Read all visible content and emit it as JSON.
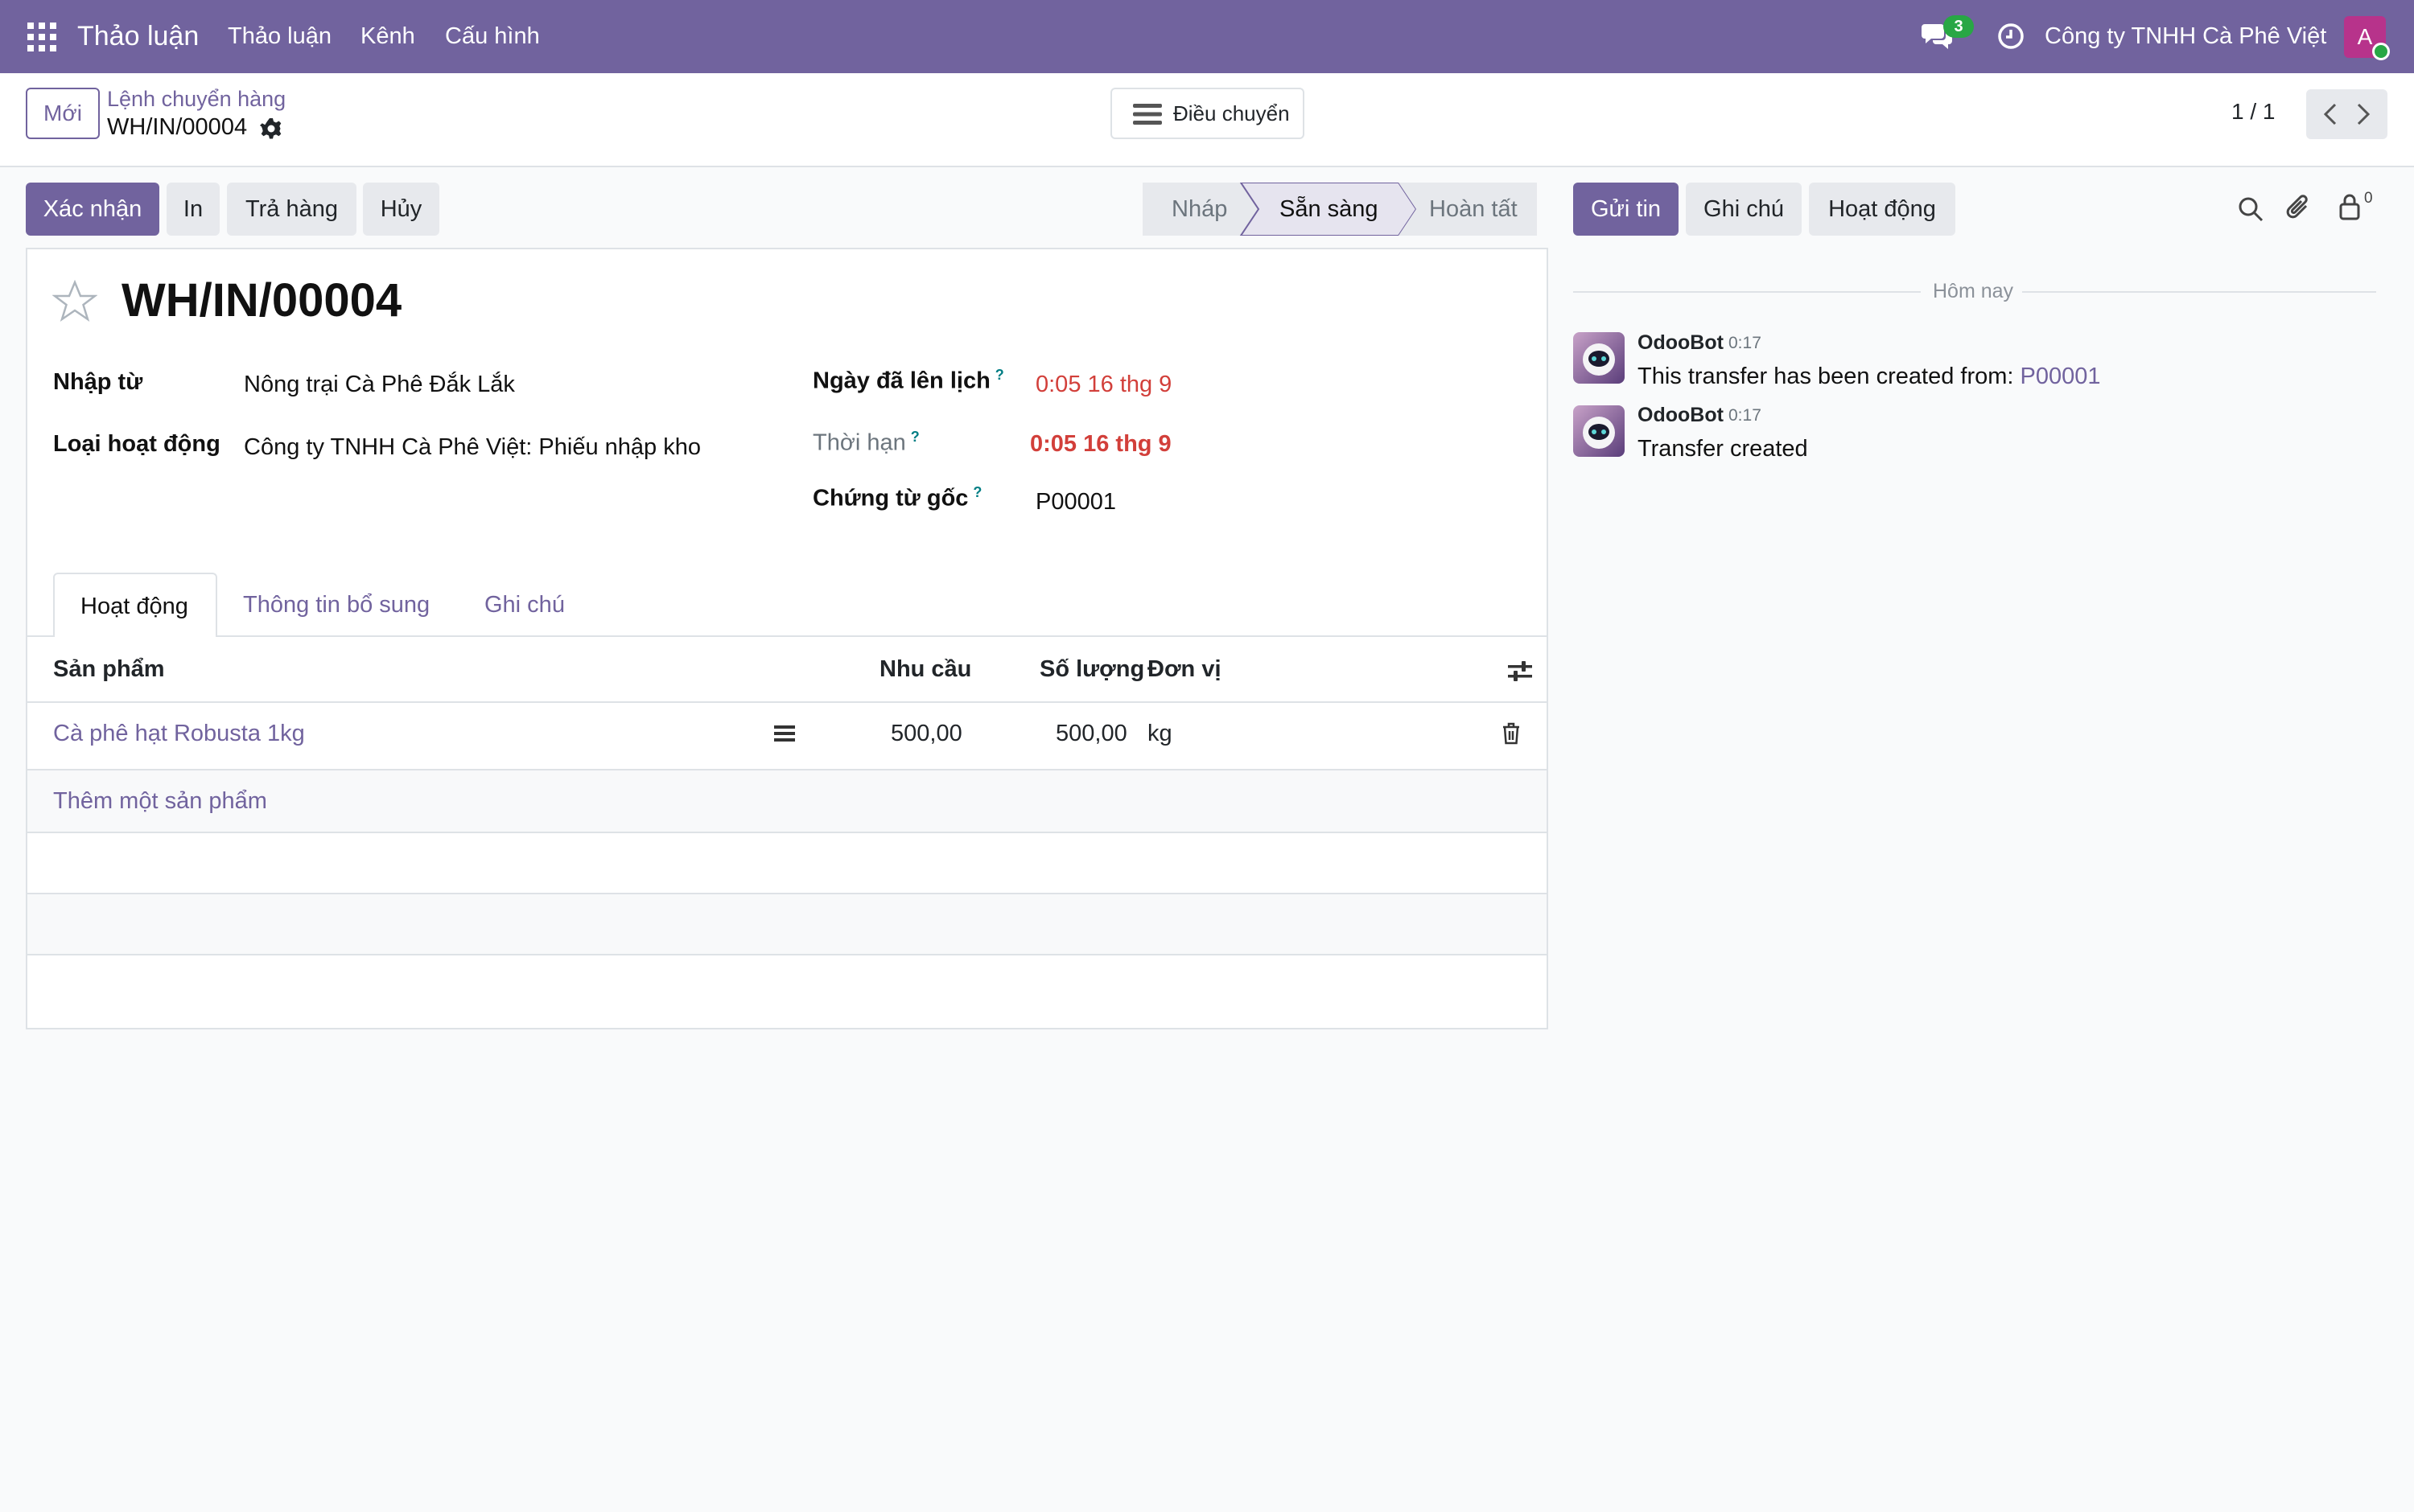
{
  "topbar": {
    "app_name": "Thảo luận",
    "menu": [
      "Thảo luận",
      "Kênh",
      "Cấu hình"
    ],
    "message_count": "3",
    "company": "Công ty TNHH Cà Phê Việt",
    "avatar_letter": "A",
    "bg_color": "#71639e"
  },
  "control_panel": {
    "new_button": "Mới",
    "breadcrumb_parent": "Lệnh chuyển hàng",
    "record_name": "WH/IN/00004",
    "actions_menu": "Điều chuyển",
    "pager": "1 / 1"
  },
  "statusbar": {
    "buttons": [
      "Xác nhận",
      "In",
      "Trả hàng",
      "Hủy"
    ],
    "stages": [
      "Nháp",
      "Sẵn sàng",
      "Hoàn tất"
    ],
    "active_stage": "Sẵn sàng"
  },
  "form": {
    "title": "WH/IN/00004",
    "fields_left": [
      {
        "label": "Nhập từ",
        "value": "Nông trại Cà Phê Đắk Lắk"
      },
      {
        "label": "Loại hoạt động",
        "value": "Công ty TNHH Cà Phê Việt: Phiếu nhập kho"
      }
    ],
    "fields_right": [
      {
        "label": "Ngày đã lên lịch",
        "help": "?",
        "value": "0:05 16 thg 9"
      },
      {
        "label": "Thời hạn",
        "help": "?",
        "value": "0:05 16 thg 9"
      },
      {
        "label": "Chứng từ gốc",
        "help": "?",
        "value": "P00001"
      }
    ],
    "tabs": [
      "Hoạt động",
      "Thông tin bổ sung",
      "Ghi chú"
    ],
    "active_tab": "Hoạt động",
    "table": {
      "headers": [
        "Sản phẩm",
        "Nhu cầu",
        "Số lượng",
        "Đơn vị"
      ],
      "rows": [
        {
          "product": "Cà phê hạt Robusta 1kg",
          "demand": "500,00",
          "quantity": "500,00",
          "uom": "kg"
        }
      ],
      "add_line": "Thêm một sản phẩm"
    }
  },
  "chatter": {
    "buttons": [
      "Gửi tin",
      "Ghi chú",
      "Hoạt động"
    ],
    "followers_count": "0",
    "date_separator": "Hôm nay",
    "messages": [
      {
        "author": "OdooBot",
        "time": "0:17",
        "body": "This transfer has been created from: ",
        "link": "P00001"
      },
      {
        "author": "OdooBot",
        "time": "0:17",
        "body": "Transfer created",
        "link": ""
      }
    ]
  }
}
